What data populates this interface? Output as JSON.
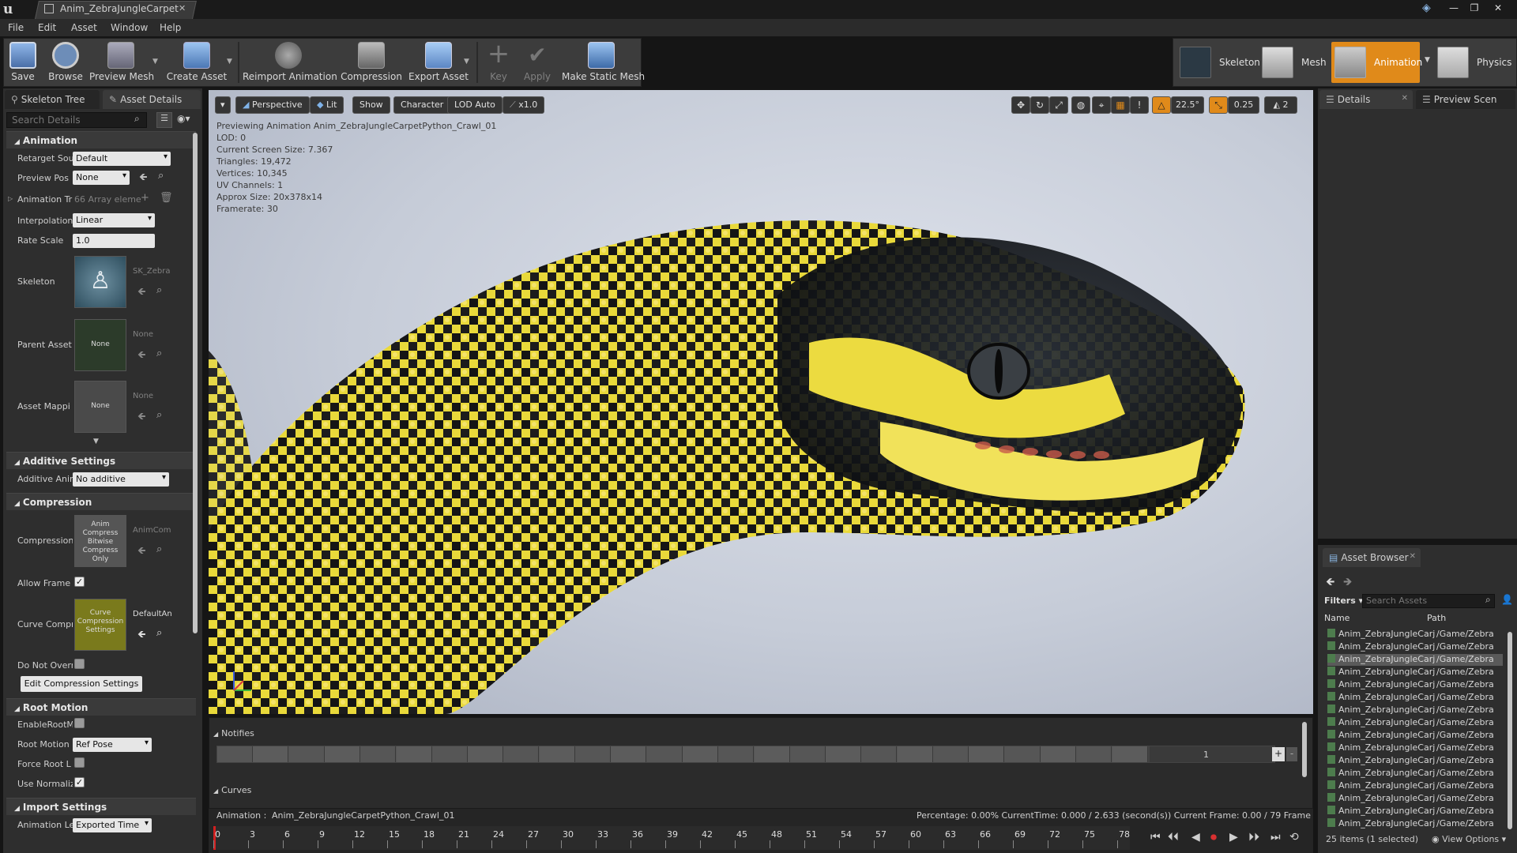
{
  "titlebar": {
    "tab_title": "Anim_ZebraJungleCarpet"
  },
  "menu": [
    "File",
    "Edit",
    "Asset",
    "Window",
    "Help"
  ],
  "toolbar": {
    "buttons": [
      "Save",
      "Browse",
      "Preview Mesh",
      "Create Asset",
      "Reimport Animation",
      "Compression",
      "Export Asset",
      "Key",
      "Apply",
      "Make Static Mesh"
    ]
  },
  "modes": [
    "Skeleton",
    "Mesh",
    "Animation",
    "Physics"
  ],
  "left_panel": {
    "tabs": [
      "Skeleton Tree",
      "Asset Details"
    ],
    "search_placeholder": "Search Details",
    "animation_section": "Animation",
    "retarget_label": "Retarget Sou",
    "retarget_value": "Default",
    "preview_pose_label": "Preview Pos",
    "preview_pose_value": "None",
    "anim_tracks_label": "Animation Tr",
    "anim_tracks_value": "66 Array eleme",
    "interpolation_label": "Interpolation",
    "interpolation_value": "Linear",
    "rate_scale_label": "Rate Scale",
    "rate_scale_value": "1.0",
    "skeleton_label": "Skeleton",
    "skeleton_value": "SK_Zebra",
    "parent_asset_label": "Parent Asset",
    "parent_asset_thumb": "None",
    "parent_asset_value": "None",
    "asset_mapping_label": "Asset Mappi",
    "asset_mapping_thumb": "None",
    "asset_mapping_value": "None",
    "additive_section": "Additive Settings",
    "additive_label": "Additive Anir",
    "additive_value": "No additive",
    "compression_section": "Compression",
    "compression_label": "Compression",
    "compression_thumb": "Anim Compress Bitwise Compress Only",
    "compression_value": "AnimCom",
    "allow_frame_label": "Allow Frame",
    "curve_label": "Curve Compr",
    "curve_thumb": "Curve Compression Settings",
    "curve_value": "DefaultAn",
    "do_not_override_label": "Do Not Overr",
    "edit_compression_button": "Edit Compression Settings",
    "root_motion_section": "Root Motion",
    "enable_root_label": "EnableRootM",
    "root_motion_label": "Root Motion",
    "root_motion_value": "Ref Pose",
    "force_root_label": "Force Root L",
    "use_normalized_label": "Use Normaliz",
    "import_section": "Import Settings",
    "anim_length_label": "Animation Le",
    "anim_length_value": "Exported Time"
  },
  "viewport": {
    "buttons": [
      "Perspective",
      "Lit",
      "Show",
      "Character",
      "LOD Auto",
      "x1.0"
    ],
    "stats": [
      "Previewing Animation Anim_ZebraJungleCarpetPython_Crawl_01",
      "LOD: 0",
      "Current Screen Size: 7.367",
      "Triangles: 19,472",
      "Vertices: 10,345",
      "UV Channels: 1",
      "Approx Size: 20x378x14",
      "Framerate: 30"
    ],
    "snap_angle": "22.5°",
    "snap_scale": "0.25",
    "camera_speed": "2"
  },
  "right_panel": {
    "tabs": [
      "Details",
      "Preview Scen"
    ]
  },
  "asset_browser": {
    "tab": "Asset Browser",
    "filters": "Filters",
    "search_placeholder": "Search Assets",
    "col_name": "Name",
    "col_path": "Path",
    "rows": [
      {
        "name": "Anim_ZebraJungleCarj",
        "path": "/Game/Zebra"
      },
      {
        "name": "Anim_ZebraJungleCarj",
        "path": "/Game/Zebra"
      },
      {
        "name": "Anim_ZebraJungleCarj",
        "path": "/Game/Zebra"
      },
      {
        "name": "Anim_ZebraJungleCarj",
        "path": "/Game/Zebra"
      },
      {
        "name": "Anim_ZebraJungleCarj",
        "path": "/Game/Zebra"
      },
      {
        "name": "Anim_ZebraJungleCarj",
        "path": "/Game/Zebra"
      },
      {
        "name": "Anim_ZebraJungleCarj",
        "path": "/Game/Zebra"
      },
      {
        "name": "Anim_ZebraJungleCarj",
        "path": "/Game/Zebra"
      },
      {
        "name": "Anim_ZebraJungleCarj",
        "path": "/Game/Zebra"
      },
      {
        "name": "Anim_ZebraJungleCarj",
        "path": "/Game/Zebra"
      },
      {
        "name": "Anim_ZebraJungleCarj",
        "path": "/Game/Zebra"
      },
      {
        "name": "Anim_ZebraJungleCarj",
        "path": "/Game/Zebra"
      },
      {
        "name": "Anim_ZebraJungleCarj",
        "path": "/Game/Zebra"
      },
      {
        "name": "Anim_ZebraJungleCarj",
        "path": "/Game/Zebra"
      },
      {
        "name": "Anim_ZebraJungleCarj",
        "path": "/Game/Zebra"
      },
      {
        "name": "Anim_ZebraJungleCarj",
        "path": "/Game/Zebra"
      }
    ],
    "selected_row": 2,
    "footer_count": "25 items (1 selected)",
    "view_options": "View Options"
  },
  "timeline": {
    "notifies": "Notifies",
    "track_number": "1",
    "curves": "Curves",
    "animation_label": "Animation :",
    "animation_name": "Anim_ZebraJungleCarpetPython_Crawl_01",
    "status_right": "Percentage:  0.00%  CurrentTime:  0.000 / 2.633 (second(s))  Current Frame:  0.00 / 79 Frame",
    "frames": [
      "0",
      "3",
      "6",
      "9",
      "12",
      "15",
      "18",
      "21",
      "24",
      "27",
      "30",
      "33",
      "36",
      "39",
      "42",
      "45",
      "48",
      "51",
      "54",
      "57",
      "60",
      "63",
      "66",
      "69",
      "72",
      "75",
      "78"
    ]
  },
  "colors": {
    "accent_orange": "#e08a1a",
    "bg": "#2e2e2e"
  }
}
